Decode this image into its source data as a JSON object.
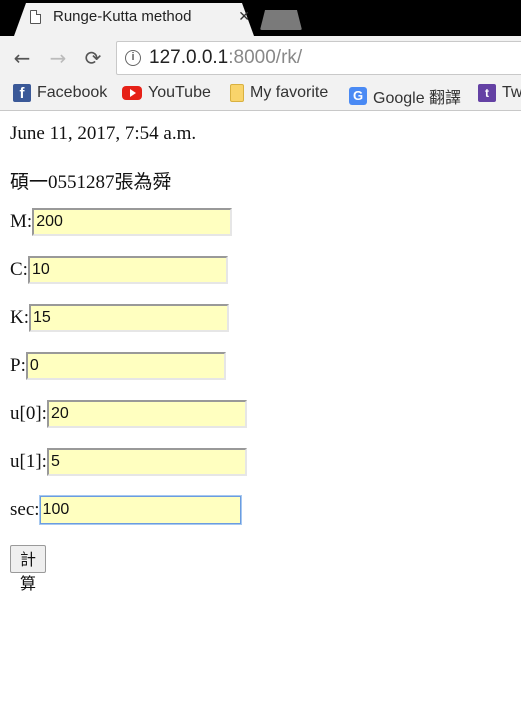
{
  "browser": {
    "tab": {
      "title": "Runge-Kutta method",
      "close_symbol": "✕"
    },
    "nav": {
      "back": "←",
      "forward": "→",
      "reload": "⟳"
    },
    "address": {
      "host": "127.0.0.1",
      "path": ":8000/rk/",
      "info_symbol": "i"
    },
    "bookmarks": [
      {
        "label": "Facebook",
        "icon": "facebook-icon"
      },
      {
        "label": "YouTube",
        "icon": "youtube-icon"
      },
      {
        "label": "My favorite",
        "icon": "folder-icon"
      },
      {
        "label": "Google 翻譯",
        "icon": "google-translate-icon"
      },
      {
        "label": "Tw",
        "icon": "twitch-icon"
      }
    ]
  },
  "page": {
    "timestamp": "June 11, 2017, 7:54 a.m.",
    "student": "碩一0551287張為舜",
    "fields": [
      {
        "label": "M:",
        "value": "200"
      },
      {
        "label": "C:",
        "value": "10"
      },
      {
        "label": "K:",
        "value": "15"
      },
      {
        "label": "P:",
        "value": "0"
      },
      {
        "label": "u[0]:",
        "value": "20"
      },
      {
        "label": "u[1]:",
        "value": "5"
      },
      {
        "label": "sec:",
        "value": "100"
      }
    ],
    "submit_label": "計算"
  },
  "colors": {
    "input_bg": "#ffffc0",
    "focus_border": "#6b9ce0",
    "tabstrip": "#000000",
    "toolbar": "#f2f2f2"
  }
}
